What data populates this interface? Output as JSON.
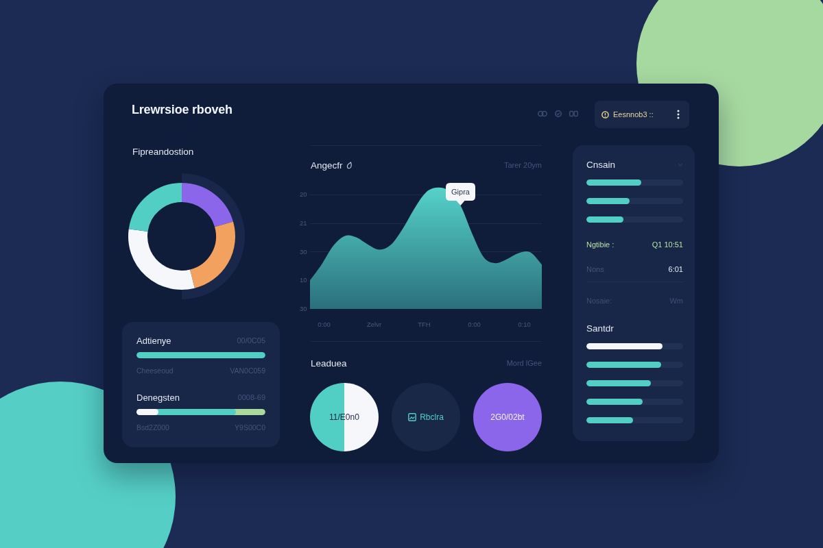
{
  "header": {
    "title": "Lrewrsioe rboveh",
    "status_button": {
      "label": "Eesnnob3 ::"
    }
  },
  "distribution": {
    "title": "Fipreandostion"
  },
  "metrics_panel": {
    "rows": [
      {
        "label": "Adtienye",
        "value": "00/0C05",
        "segments": [
          {
            "color": "#52cfc5",
            "level": 1
          }
        ],
        "caption_left": "Cheeseoud",
        "caption_right": "VAN0C059"
      },
      {
        "label": "Denegsten",
        "value": "0008-69",
        "segments": [
          {
            "color": "#f5f7fb",
            "level": 0.17
          },
          {
            "color": "#52cfc5",
            "level": 0.77
          },
          {
            "color": "#a9da9c",
            "level": 1
          }
        ],
        "caption_left": "Bsd2Z000",
        "caption_right": "Y9S00C0"
      }
    ]
  },
  "trend": {
    "title": "Angecfr",
    "subtitle": "Tarer 20ym",
    "y_axis_labels": [
      "20",
      "21",
      "30",
      "10",
      "30"
    ],
    "x_axis_labels": [
      "0:00",
      "Zelvr",
      "TFH",
      "0:00",
      "0:10"
    ],
    "tooltip": "Gipra"
  },
  "leaders": {
    "title": "Leaduea",
    "link": "Mord lGee",
    "items": [
      {
        "kind": "split",
        "label": "11/E0n0"
      },
      {
        "kind": "icon",
        "label": "Rbclra"
      },
      {
        "kind": "solid",
        "label": "2G0/02bt",
        "color": "#8b65ea"
      }
    ]
  },
  "side_panel": {
    "title": "Cnsain",
    "bars": [
      {
        "level": 0.57
      },
      {
        "level": 0.45
      },
      {
        "level": 0.38
      }
    ],
    "stats": [
      {
        "kind": "accent",
        "label": "Ngtibie :",
        "value": "Q1 10:51"
      },
      {
        "kind": "plain",
        "label": "Nons",
        "value": "6:01"
      },
      {
        "kind": "muted",
        "label": "Nosaie:",
        "value": "Wm"
      }
    ],
    "section_title": "Santdr",
    "section_bars": [
      {
        "level": 0.79,
        "color": "#f5f7fb"
      },
      {
        "level": 0.77,
        "color": "#52cfc5"
      },
      {
        "level": 0.67,
        "color": "#52cfc5"
      },
      {
        "level": 0.58,
        "color": "#52cfc5"
      },
      {
        "level": 0.48,
        "color": "#52cfc5"
      }
    ]
  }
}
